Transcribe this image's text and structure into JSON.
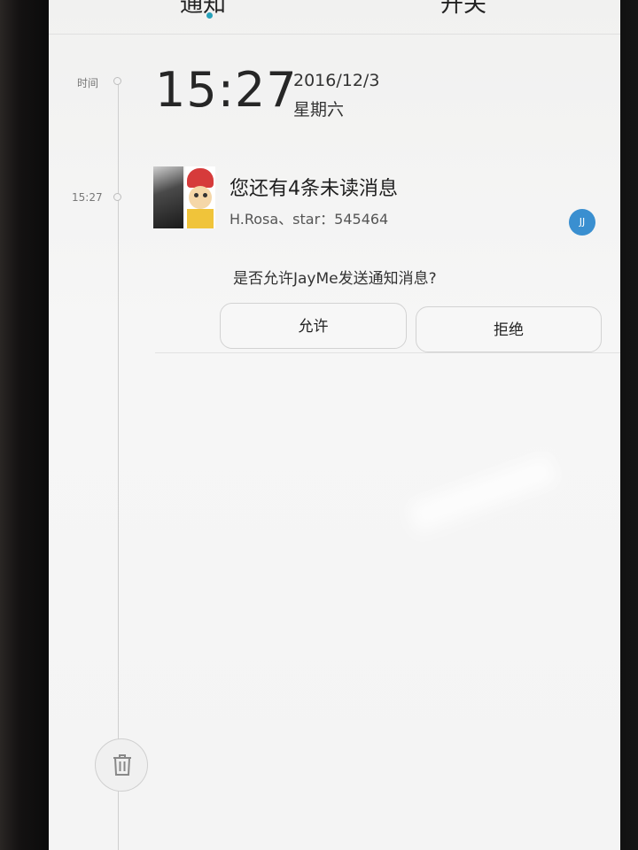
{
  "tabs": {
    "notifications": "通知",
    "switches": "开关"
  },
  "timeline": {
    "label_time": "时间",
    "label_notif_time": "15:27"
  },
  "clock": {
    "time": "15:27",
    "date": "2016/12/3",
    "weekday": "星期六"
  },
  "notification": {
    "title": "您还有4条未读消息",
    "subtitle": "H.Rosa、star：545464",
    "app_icon": "JayMe-app-icon",
    "app_badge_text": "JJ"
  },
  "permission": {
    "question": "是否允许JayMe发送通知消息?",
    "allow_label": "允许",
    "deny_label": "拒绝"
  },
  "colors": {
    "accent": "#27a1b9",
    "badge": "#3a8fd0"
  },
  "icons": {
    "clear": "trash-icon"
  }
}
